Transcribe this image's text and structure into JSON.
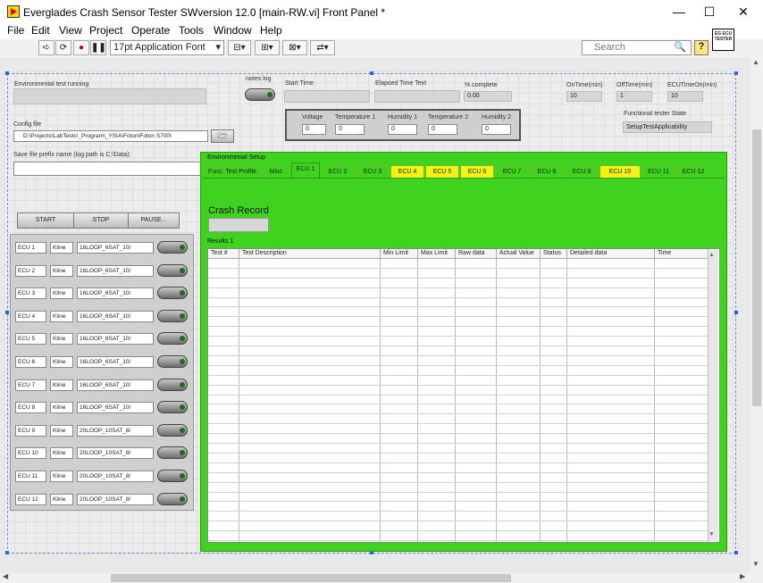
{
  "window": {
    "title": "Everglades Crash Sensor Tester SWversion 12.0 [main-RW.vi] Front Panel *",
    "minimize": "—",
    "maximize": "☐",
    "close": "✕"
  },
  "menu": [
    "File",
    "Edit",
    "View",
    "Project",
    "Operate",
    "Tools",
    "Window",
    "Help"
  ],
  "toolbar": {
    "font": "17pt Application Font",
    "search_placeholder": "Search",
    "help": "?"
  },
  "logo": {
    "text": "EG ECU TESTER"
  },
  "panel": {
    "env_test_label": "Environmental test running",
    "notes_log_label": "notes log",
    "start_time_label": "Start Time",
    "elapsed_label": "Elapsed Time Text",
    "pct_label": "% complete",
    "pct_value": "0.00",
    "ontime_label": "OnTime(min)",
    "ontime_value": "10",
    "offtime_label": "OffTime(min)",
    "offtime_value": "1",
    "ecuon_label": "ECUTimeOn(min)",
    "ecuon_value": "10",
    "voltage_label": "Voltage",
    "voltage_value": "0",
    "temp1_label": "Temperature 1",
    "temp1_value": "0",
    "hum1_label": "Humidity 1",
    "hum1_value": "0",
    "temp2_label": "Temperature 2",
    "temp2_value": "0",
    "hum2_label": "Humidity 2",
    "hum2_value": "0",
    "func_state_label": "Functional tester State",
    "func_state_value": "SetupTestApplicability",
    "config_label": "Config file",
    "config_value": "D:\\Projects\\LabTests\\_Program\\_YSIA\\Foton\\Foton S700\\",
    "prefix_label": "Save file prefix name (log path is C:\\Data):",
    "start_btn": "START",
    "stop_btn": "STOP",
    "pause_btn": "PAUSE..."
  },
  "ecus": [
    {
      "name": "ECU 1",
      "proto": "Kline",
      "config": "16LOOP_6SAT_10/"
    },
    {
      "name": "ECU 2",
      "proto": "Kline",
      "config": "16LOOP_6SAT_10/"
    },
    {
      "name": "ECU 3",
      "proto": "Kline",
      "config": "16LOOP_6SAT_10/"
    },
    {
      "name": "ECU 4",
      "proto": "Kline",
      "config": "16LOOP_6SAT_10/"
    },
    {
      "name": "ECU 5",
      "proto": "Kline",
      "config": "16LOOP_6SAT_10/"
    },
    {
      "name": "ECU 6",
      "proto": "Kline",
      "config": "16LOOP_6SAT_10/"
    },
    {
      "name": "ECU 7",
      "proto": "Kline",
      "config": "16LOOP_6SAT_10/"
    },
    {
      "name": "ECU 8",
      "proto": "Kline",
      "config": "16LOOP_6SAT_10/"
    },
    {
      "name": "ECU 9",
      "proto": "Kline",
      "config": "20LOOP_10SAT_8/"
    },
    {
      "name": "ECU 10",
      "proto": "Kline",
      "config": "20LOOP_10SAT_8/"
    },
    {
      "name": "ECU 11",
      "proto": "Kline",
      "config": "20LOOP_10SAT_8/"
    },
    {
      "name": "ECU 12",
      "proto": "Kline",
      "config": "20LOOP_10SAT_8/"
    }
  ],
  "tabs_group_label": "Environmental Setup",
  "tabs": [
    {
      "label": "Func. Test Profile",
      "color": "#3fd21e"
    },
    {
      "label": "Misc",
      "color": "#3fd21e"
    },
    {
      "label": "ECU 1",
      "color": "#3fd21e"
    },
    {
      "label": "ECU 2",
      "color": "#3fd21e"
    },
    {
      "label": "ECU 3",
      "color": "#3fd21e"
    },
    {
      "label": "ECU 4",
      "color": "#f5f316"
    },
    {
      "label": "ECU 5",
      "color": "#f5f316"
    },
    {
      "label": "ECU 6",
      "color": "#f5f316"
    },
    {
      "label": "ECU 7",
      "color": "#3fd21e"
    },
    {
      "label": "ECU 8",
      "color": "#3fd21e"
    },
    {
      "label": "ECU 9",
      "color": "#3fd21e"
    },
    {
      "label": "ECU 10",
      "color": "#f5f316"
    },
    {
      "label": "ECU 11",
      "color": "#3fd21e"
    },
    {
      "label": "ECU 12",
      "color": "#3fd21e"
    }
  ],
  "crash_record_label": "Crash Record",
  "results_label": "Results 1",
  "table_headers": [
    "Test #",
    "Test Description",
    "Min Limit",
    "Max Limit",
    "Raw data",
    "Actual Value",
    "Status",
    "Detailed data",
    "Time"
  ]
}
